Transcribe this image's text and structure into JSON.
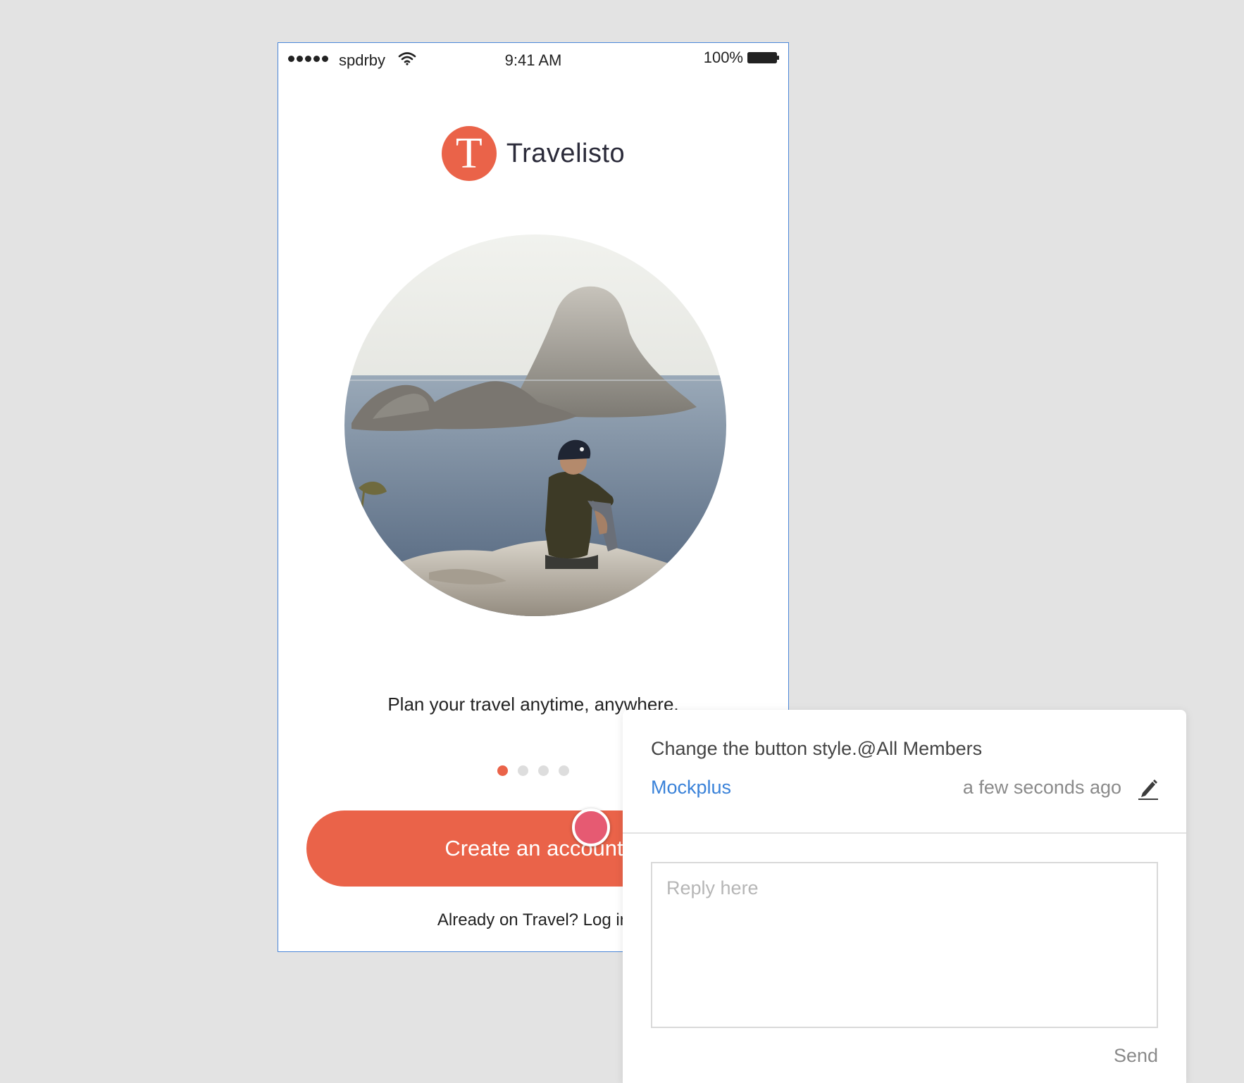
{
  "status_bar": {
    "carrier": "spdrby",
    "time": "9:41 AM",
    "battery": "100%"
  },
  "app": {
    "logo_letter": "T",
    "name": "Travelisto",
    "hero_image": "person-on-cliff-overlooking-sea-islands",
    "tagline": "Plan your travel anytime, anywhere.",
    "pager": {
      "pages": 4,
      "current": 1
    },
    "cta_label": "Create an account",
    "login_prompt": "Already on Travel? Log in"
  },
  "comment": {
    "text": "Change the button style.@All Members",
    "author": "Mockplus",
    "time": "a few seconds ago",
    "reply_placeholder": "Reply here",
    "send_label": "Send"
  },
  "colors": {
    "brand": "#ea6349",
    "pin": "#e65a72",
    "link": "#3a82d9",
    "frame_border": "#4a86d8",
    "canvas": "#e3e3e3"
  }
}
